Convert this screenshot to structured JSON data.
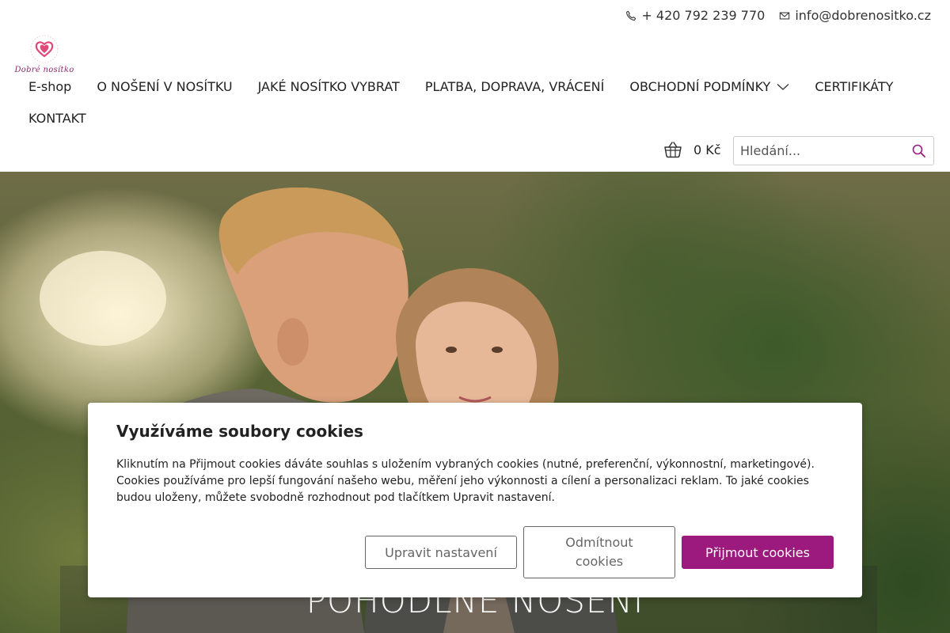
{
  "header": {
    "phone": "+ 420 792 239 770",
    "email": "info@dobrenositko.cz",
    "logo_text": "Dobré nosítko",
    "cart_total": "0 Kč",
    "search_placeholder": "Hledání..."
  },
  "nav": {
    "items": [
      {
        "label": "E-shop"
      },
      {
        "label": "O NOŠENÍ V NOSÍTKU"
      },
      {
        "label": "JAKÉ NOSÍTKO VYBRAT"
      },
      {
        "label": "PLATBA, DOPRAVA, VRÁCENÍ"
      },
      {
        "label": "OBCHODNÍ PODMÍNKY",
        "has_dropdown": true
      },
      {
        "label": "CERTIFIKÁTY"
      },
      {
        "label": "KONTAKT"
      }
    ]
  },
  "hero": {
    "title": "POHODLNÉ NOŠENÍ"
  },
  "cookie": {
    "title": "Využíváme soubory cookies",
    "text": "Kliknutím na Přijmout cookies dáváte souhlas s uložením vybraných cookies (nutné, preferenční, výkonnostní, marketingové). Cookies používáme pro lepší fungování našeho webu, měření jeho výkonnosti a cílení a personalizaci reklam. To jaké cookies budou uloženy, můžete svobodně rozhodnout pod tlačítkem Upravit nastavení.",
    "settings_label": "Upravit nastavení",
    "reject_label": "Odmítnout cookies",
    "accept_label": "Přijmout cookies"
  },
  "colors": {
    "accent": "#9c1a7e",
    "logo_pink": "#e0487a"
  }
}
